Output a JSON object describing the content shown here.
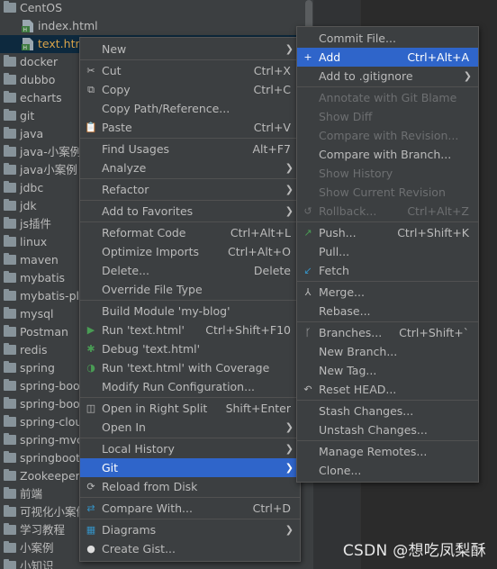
{
  "project_tree": {
    "items": [
      {
        "label": "CentOS",
        "kind": "folder",
        "indent": 0
      },
      {
        "label": "index.html",
        "kind": "html",
        "indent": 1
      },
      {
        "label": "text.html",
        "kind": "html",
        "indent": 1,
        "selected": true
      },
      {
        "label": "docker",
        "kind": "folder",
        "indent": 0
      },
      {
        "label": "dubbo",
        "kind": "folder",
        "indent": 0
      },
      {
        "label": "echarts",
        "kind": "folder",
        "indent": 0
      },
      {
        "label": "git",
        "kind": "folder",
        "indent": 0
      },
      {
        "label": "java",
        "kind": "folder",
        "indent": 0
      },
      {
        "label": "java-小案例",
        "kind": "folder",
        "indent": 0
      },
      {
        "label": "java小案例",
        "kind": "folder",
        "indent": 0
      },
      {
        "label": "jdbc",
        "kind": "folder",
        "indent": 0
      },
      {
        "label": "jdk",
        "kind": "folder",
        "indent": 0
      },
      {
        "label": "js插件",
        "kind": "folder",
        "indent": 0
      },
      {
        "label": "linux",
        "kind": "folder",
        "indent": 0
      },
      {
        "label": "maven",
        "kind": "folder",
        "indent": 0
      },
      {
        "label": "mybatis",
        "kind": "folder",
        "indent": 0
      },
      {
        "label": "mybatis-plus",
        "kind": "folder",
        "indent": 0
      },
      {
        "label": "mysql",
        "kind": "folder",
        "indent": 0
      },
      {
        "label": "Postman",
        "kind": "folder",
        "indent": 0
      },
      {
        "label": "redis",
        "kind": "folder",
        "indent": 0
      },
      {
        "label": "spring",
        "kind": "folder",
        "indent": 0
      },
      {
        "label": "spring-boot",
        "kind": "folder",
        "indent": 0
      },
      {
        "label": "spring-boot",
        "kind": "folder",
        "indent": 0
      },
      {
        "label": "spring-cloud",
        "kind": "folder",
        "indent": 0
      },
      {
        "label": "spring-mvc",
        "kind": "folder",
        "indent": 0
      },
      {
        "label": "springboot",
        "kind": "folder",
        "indent": 0
      },
      {
        "label": "Zookeeper",
        "kind": "folder",
        "indent": 0
      },
      {
        "label": "前端",
        "kind": "folder",
        "indent": 0
      },
      {
        "label": "可视化小案例",
        "kind": "folder",
        "indent": 0
      },
      {
        "label": "学习教程",
        "kind": "folder",
        "indent": 0
      },
      {
        "label": "小案例",
        "kind": "folder",
        "indent": 0
      },
      {
        "label": "小知识",
        "kind": "folder",
        "indent": 0
      }
    ]
  },
  "context_menu": {
    "items": [
      {
        "label": "New",
        "arrow": true
      },
      {
        "sep": true
      },
      {
        "label": "Cut",
        "shortcut": "Ctrl+X",
        "icon": "cut-icon"
      },
      {
        "label": "Copy",
        "shortcut": "Ctrl+C",
        "icon": "copy-icon"
      },
      {
        "label": "Copy Path/Reference..."
      },
      {
        "label": "Paste",
        "shortcut": "Ctrl+V",
        "icon": "paste-icon"
      },
      {
        "sep": true
      },
      {
        "label": "Find Usages",
        "shortcut": "Alt+F7"
      },
      {
        "label": "Analyze",
        "arrow": true
      },
      {
        "sep": true
      },
      {
        "label": "Refactor",
        "arrow": true
      },
      {
        "sep": true
      },
      {
        "label": "Add to Favorites",
        "arrow": true
      },
      {
        "sep": true
      },
      {
        "label": "Reformat Code",
        "shortcut": "Ctrl+Alt+L"
      },
      {
        "label": "Optimize Imports",
        "shortcut": "Ctrl+Alt+O"
      },
      {
        "label": "Delete...",
        "shortcut": "Delete"
      },
      {
        "label": "Override File Type"
      },
      {
        "sep": true
      },
      {
        "label": "Build Module 'my-blog'"
      },
      {
        "label": "Run 'text.html'",
        "shortcut": "Ctrl+Shift+F10",
        "icon": "run-icon"
      },
      {
        "label": "Debug 'text.html'",
        "icon": "debug-icon"
      },
      {
        "label": "Run 'text.html' with Coverage",
        "icon": "coverage-icon"
      },
      {
        "label": "Modify Run Configuration..."
      },
      {
        "sep": true
      },
      {
        "label": "Open in Right Split",
        "shortcut": "Shift+Enter",
        "icon": "split-icon"
      },
      {
        "label": "Open In",
        "arrow": true
      },
      {
        "sep": true
      },
      {
        "label": "Local History",
        "arrow": true
      },
      {
        "label": "Git",
        "arrow": true,
        "highlight": true
      },
      {
        "label": "Reload from Disk",
        "icon": "reload-icon"
      },
      {
        "sep": true
      },
      {
        "label": "Compare With...",
        "shortcut": "Ctrl+D",
        "icon": "compare-icon"
      },
      {
        "sep": true
      },
      {
        "label": "Diagrams",
        "arrow": true,
        "icon": "diagram-icon"
      },
      {
        "label": "Create Gist...",
        "icon": "github-icon"
      }
    ]
  },
  "git_submenu": {
    "items": [
      {
        "label": "Commit File..."
      },
      {
        "label": "Add",
        "shortcut": "Ctrl+Alt+A",
        "icon": "add-icon",
        "highlight": true
      },
      {
        "label": "Add to .gitignore",
        "arrow": true
      },
      {
        "sep": true
      },
      {
        "label": "Annotate with Git Blame",
        "disabled": true
      },
      {
        "label": "Show Diff",
        "disabled": true
      },
      {
        "label": "Compare with Revision...",
        "disabled": true
      },
      {
        "label": "Compare with Branch..."
      },
      {
        "label": "Show History",
        "disabled": true
      },
      {
        "label": "Show Current Revision",
        "disabled": true
      },
      {
        "label": "Rollback...",
        "shortcut": "Ctrl+Alt+Z",
        "disabled": true,
        "icon": "rollback-icon"
      },
      {
        "sep": true
      },
      {
        "label": "Push...",
        "shortcut": "Ctrl+Shift+K",
        "icon": "push-icon"
      },
      {
        "label": "Pull..."
      },
      {
        "label": "Fetch",
        "icon": "fetch-icon"
      },
      {
        "sep": true
      },
      {
        "label": "Merge...",
        "icon": "merge-icon"
      },
      {
        "label": "Rebase..."
      },
      {
        "sep": true
      },
      {
        "label": "Branches...",
        "shortcut": "Ctrl+Shift+`",
        "icon": "branch-icon"
      },
      {
        "label": "New Branch..."
      },
      {
        "label": "New Tag..."
      },
      {
        "label": "Reset HEAD...",
        "icon": "reset-icon"
      },
      {
        "sep": true
      },
      {
        "label": "Stash Changes..."
      },
      {
        "label": "Unstash Changes..."
      },
      {
        "sep": true
      },
      {
        "label": "Manage Remotes..."
      },
      {
        "label": "Clone..."
      }
    ]
  },
  "colors": {
    "highlight": "#2f65ca",
    "background": "#3c3f41",
    "text": "#bbbbbb",
    "disabled": "#6d6f71"
  },
  "watermark": "CSDN @想吃凤梨酥"
}
